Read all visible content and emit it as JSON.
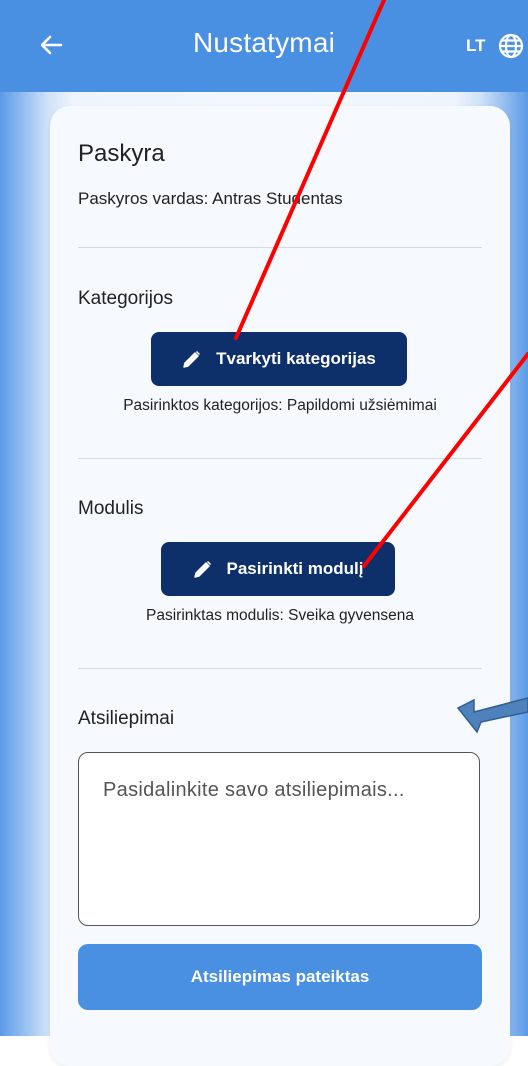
{
  "appbar": {
    "title": "Nustatymai",
    "language": "LT",
    "back_icon": "arrow-left-icon",
    "language_icon": "globe-icon"
  },
  "account": {
    "heading": "Paskyra",
    "username_line": "Paskyros vardas: Antras Studentas"
  },
  "categories": {
    "heading": "Kategorijos",
    "button_label": "Tvarkyti kategorijas",
    "selected_line": "Pasirinktos kategorijos: Papildomi užsiėmimai"
  },
  "module": {
    "heading": "Modulis",
    "button_label": "Pasirinkti modulį",
    "selected_line": "Pasirinktas modulis: Sveika gyvensena"
  },
  "feedback": {
    "heading": "Atsiliepimai",
    "placeholder": "Pasidalinkite savo atsiliepimais...",
    "submit_label": "Atsiliepimas pateiktas"
  },
  "colors": {
    "appbar": "#4a90e2",
    "dark_button": "#0d2f6a",
    "annotation_red": "#ff0000",
    "annotation_arrow": "#4f81bd"
  }
}
